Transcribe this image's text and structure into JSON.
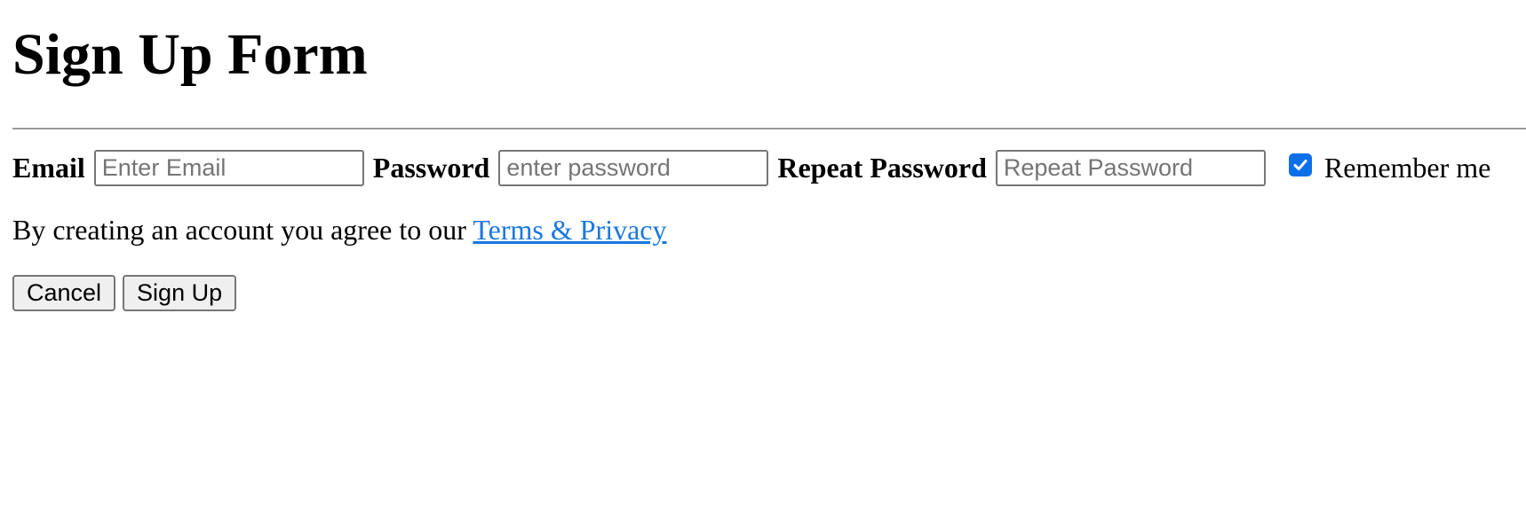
{
  "page": {
    "title": "Sign Up Form"
  },
  "form": {
    "email": {
      "label": "Email",
      "value": "",
      "placeholder": "Enter Email"
    },
    "password": {
      "label": "Password",
      "value": "",
      "placeholder": "enter password"
    },
    "repeat_password": {
      "label": "Repeat Password",
      "value": "",
      "placeholder": "Repeat Password"
    },
    "remember": {
      "label": "Remember me",
      "checked": true,
      "icon": "checkmark-icon"
    }
  },
  "agreement": {
    "text": "By creating an account you agree to our ",
    "link_text": "Terms & Privacy"
  },
  "actions": {
    "cancel_label": "Cancel",
    "signup_label": "Sign Up"
  },
  "colors": {
    "link": "#1a78e0",
    "checkbox_accent": "#0b6fe8",
    "button_background": "#efefef",
    "input_border": "#767676",
    "divider": "#9a9a9a"
  }
}
